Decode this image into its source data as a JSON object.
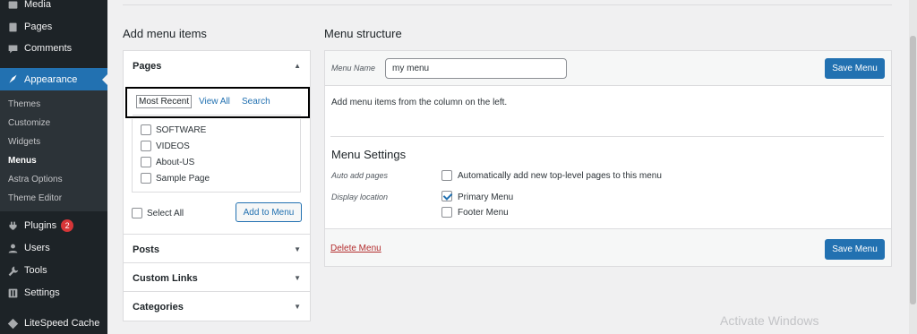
{
  "sidebar": {
    "items": [
      {
        "label": "Media",
        "icon": "media-icon"
      },
      {
        "label": "Pages",
        "icon": "pages-icon"
      },
      {
        "label": "Comments",
        "icon": "comments-icon"
      },
      {
        "label": "Appearance",
        "icon": "appearance-icon"
      },
      {
        "label": "Plugins",
        "icon": "plugins-icon",
        "badge": "2"
      },
      {
        "label": "Users",
        "icon": "users-icon"
      },
      {
        "label": "Tools",
        "icon": "tools-icon"
      },
      {
        "label": "Settings",
        "icon": "settings-icon"
      },
      {
        "label": "LiteSpeed Cache",
        "icon": "litespeed-icon"
      }
    ],
    "submenu": [
      "Themes",
      "Customize",
      "Widgets",
      "Menus",
      "Astra Options",
      "Theme Editor"
    ]
  },
  "left": {
    "heading": "Add menu items",
    "pages_title": "Pages",
    "tabs": [
      "Most Recent",
      "View All",
      "Search"
    ],
    "pages": [
      "SOFTWARE",
      "VIDEOS",
      "About-US",
      "Sample Page"
    ],
    "select_all": "Select All",
    "add_button": "Add to Menu",
    "sections": [
      "Posts",
      "Custom Links",
      "Categories"
    ]
  },
  "right": {
    "heading": "Menu structure",
    "name_label": "Menu Name",
    "name_value": "my menu",
    "save_label": "Save Menu",
    "instructions": "Add menu items from the column on the left.",
    "settings_title": "Menu Settings",
    "auto_add_label": "Auto add pages",
    "auto_add_option": "Automatically add new top-level pages to this menu",
    "display_label": "Display location",
    "locations": [
      {
        "label": "Primary Menu",
        "checked": true
      },
      {
        "label": "Footer Menu",
        "checked": false
      }
    ],
    "delete_label": "Delete Menu"
  },
  "watermark": "Activate Windows",
  "colors": {
    "accent": "#2271b1",
    "sidebar": "#1d2327",
    "danger": "#b32d2e",
    "badge": "#d63638"
  }
}
